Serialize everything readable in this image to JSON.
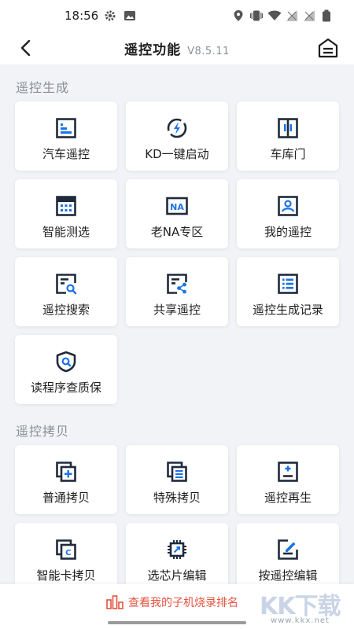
{
  "status_bar": {
    "time": "18:56"
  },
  "header": {
    "title": "遥控功能",
    "version": "V8.5.11"
  },
  "colors": {
    "accent": "#1a73e8",
    "icon_dark": "#1f2a3c",
    "link_red": "#e5533d"
  },
  "sections": [
    {
      "title": "遥控生成",
      "items": [
        {
          "label": "汽车遥控",
          "icon": "car-remote-icon"
        },
        {
          "label": "KD一键启动",
          "icon": "one-key-start-icon"
        },
        {
          "label": "车库门",
          "icon": "garage-door-icon"
        },
        {
          "label": "智能测选",
          "icon": "smart-detect-icon"
        },
        {
          "label": "老NA专区",
          "icon": "na-zone-icon"
        },
        {
          "label": "我的遥控",
          "icon": "my-remote-icon"
        },
        {
          "label": "遥控搜索",
          "icon": "remote-search-icon"
        },
        {
          "label": "共享遥控",
          "icon": "share-remote-icon"
        },
        {
          "label": "遥控生成记录",
          "icon": "generation-record-icon"
        },
        {
          "label": "读程序查质保",
          "icon": "warranty-check-icon"
        }
      ]
    },
    {
      "title": "遥控拷贝",
      "items": [
        {
          "label": "普通拷贝",
          "icon": "normal-copy-icon"
        },
        {
          "label": "特殊拷贝",
          "icon": "special-copy-icon"
        },
        {
          "label": "遥控再生",
          "icon": "remote-regenerate-icon"
        },
        {
          "label": "智能卡拷贝",
          "icon": "smart-card-copy-icon"
        },
        {
          "label": "选芯片编辑",
          "icon": "chip-edit-icon"
        },
        {
          "label": "按遥控编辑",
          "icon": "remote-edit-icon"
        }
      ]
    }
  ],
  "bottom": {
    "link_text": "查看我的子机烧录排名",
    "watermark_brand": "KK下载",
    "watermark_url": "www.kkx.net"
  }
}
